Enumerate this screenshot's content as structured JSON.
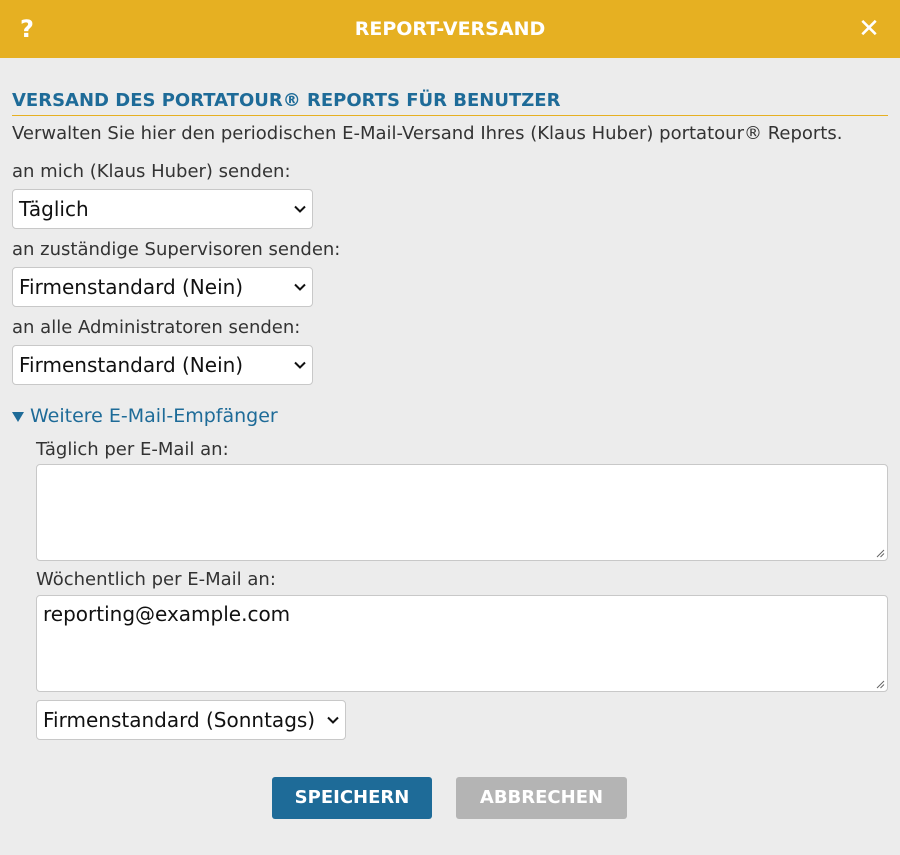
{
  "dialog": {
    "help_icon": "?",
    "title": "REPORT-VERSAND",
    "close_icon": "✕"
  },
  "section": {
    "title": "VERSAND DES PORTATOUR® REPORTS FÜR BENUTZER",
    "intro": "Verwalten Sie hier den periodischen E-Mail-Versand Ihres (Klaus Huber) portatour® Reports."
  },
  "fields": {
    "me": {
      "label": "an mich (Klaus Huber) senden:",
      "value": "Täglich"
    },
    "supervisors": {
      "label": "an zuständige Supervisoren senden:",
      "value": "Firmenstandard (Nein)"
    },
    "admins": {
      "label": "an alle Administratoren senden:",
      "value": "Firmenstandard (Nein)"
    }
  },
  "more_recipients": {
    "toggle_label": "Weitere E-Mail-Empfänger",
    "daily": {
      "label": "Täglich per E-Mail an:",
      "value": ""
    },
    "weekly": {
      "label": "Wöchentlich per E-Mail an:",
      "value": "reporting@example.com"
    },
    "weekly_day": "Firmenstandard (Sonntags)"
  },
  "buttons": {
    "save": "SPEICHERN",
    "cancel": "ABBRECHEN"
  },
  "colors": {
    "header": "#e6b022",
    "primary": "#1e6b98",
    "disabled": "#b4b4b4"
  }
}
